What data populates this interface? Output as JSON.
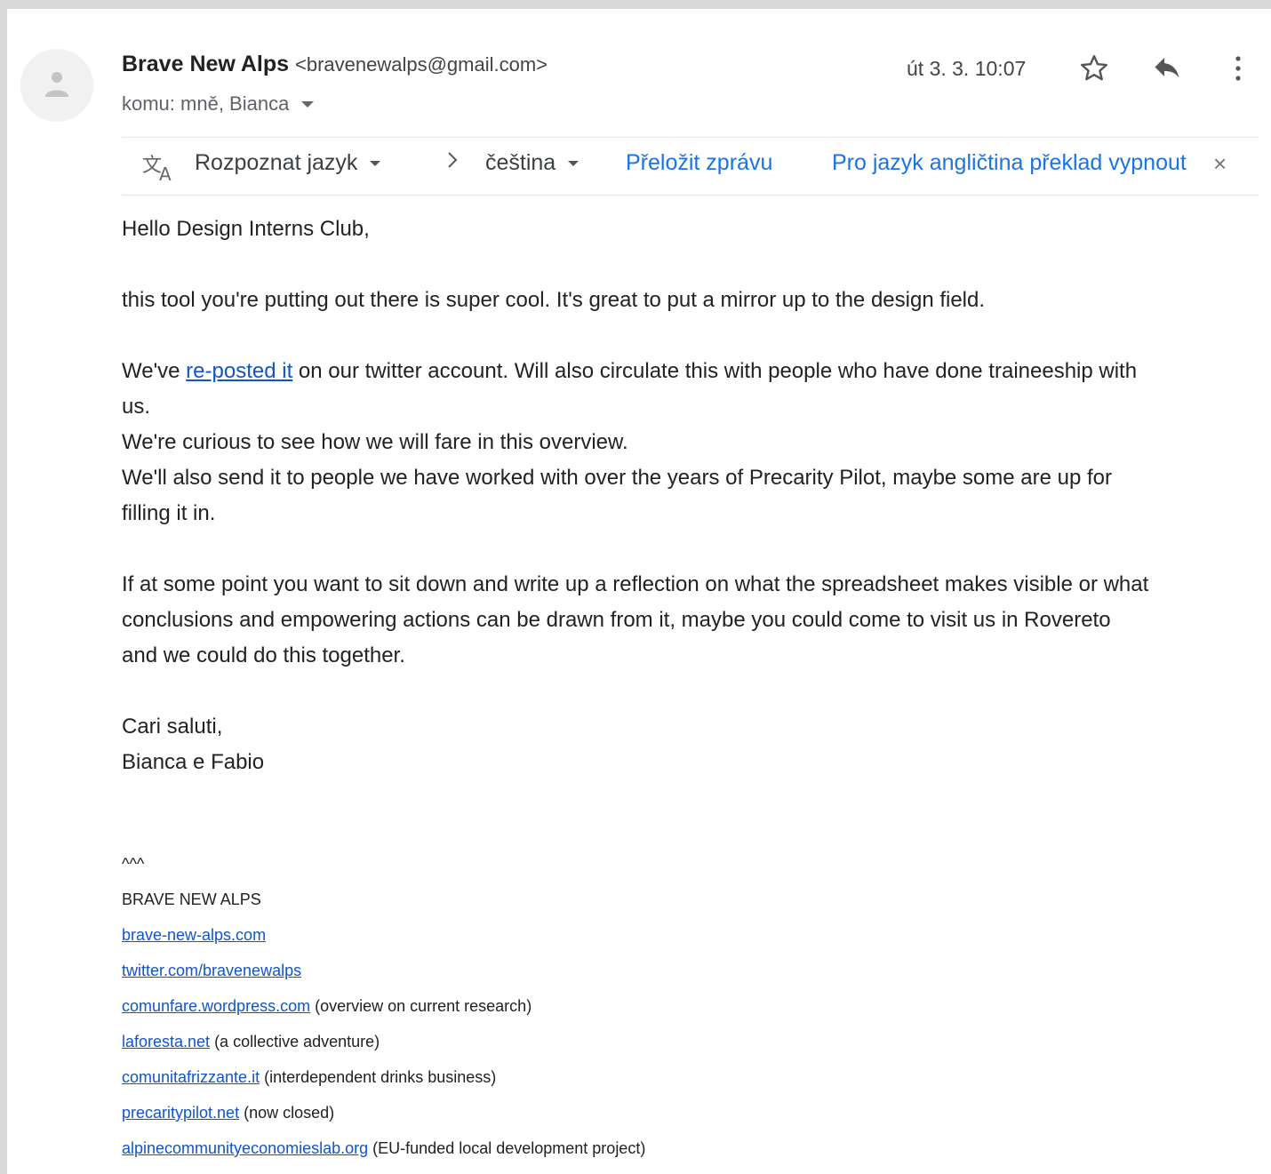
{
  "header": {
    "sender_name": "Brave New Alps",
    "sender_email": "<bravenewalps@gmail.com>",
    "recipients": "komu: mně, Bianca",
    "date": "út 3. 3. 10:07"
  },
  "icons": {
    "avatar": "person-icon",
    "star": "star-icon",
    "reply": "reply-icon",
    "more": "more-vert-icon",
    "translate": "translate-icon",
    "arrow": "chevron-right-icon",
    "close": "close-icon"
  },
  "translate_bar": {
    "detect_language": "Rozpoznat jazyk",
    "target_language": "čeština",
    "translate_message": "Přeložit zprávu",
    "disable_translation": "Pro jazyk angličtina překlad vypnout",
    "close": "×"
  },
  "body": {
    "greeting": "Hello Design Interns Club,",
    "p1": "this tool you're putting out there is super cool. It's great to put a mirror up to the design field.",
    "p2_before": "We've ",
    "p2_link": "re-posted it",
    "p2_after_line1": " on our twitter account. Will also circulate this with people who have done traineeship with",
    "p2_after_line2": "us.",
    "p3": "We're curious to see how we will fare in this overview.",
    "p4_line1": "We'll also send it to people we have worked with over the years of Precarity Pilot, maybe some are up for",
    "p4_line2": "filling it in.",
    "p5_line1": "If at some point you want to sit down and write up a reflection on what the spreadsheet makes visible or what",
    "p5_line2": "conclusions and empowering actions can be drawn from it, maybe you could come to visit us in Rovereto",
    "p5_line3": "and we could do this together.",
    "closing": "Cari saluti,",
    "names": "Bianca e Fabio"
  },
  "signature": {
    "mark": "^^^",
    "org": "BRAVE NEW ALPS",
    "links": [
      {
        "url": "brave-new-alps.com",
        "note": ""
      },
      {
        "url": "twitter.com/bravenewalps",
        "note": ""
      },
      {
        "url": "comunfare.wordpress.com",
        "note": " (overview on current research)"
      },
      {
        "url": "laforesta.net",
        "note": " (a collective adventure)"
      },
      {
        "url": "comunitafrizzante.it",
        "note": " (interdependent drinks business)"
      },
      {
        "url": "precaritypilot.net",
        "note": " (now closed)"
      },
      {
        "url": "alpinecommunityeconomieslab.org",
        "note": " (EU-funded local development project)"
      }
    ]
  }
}
